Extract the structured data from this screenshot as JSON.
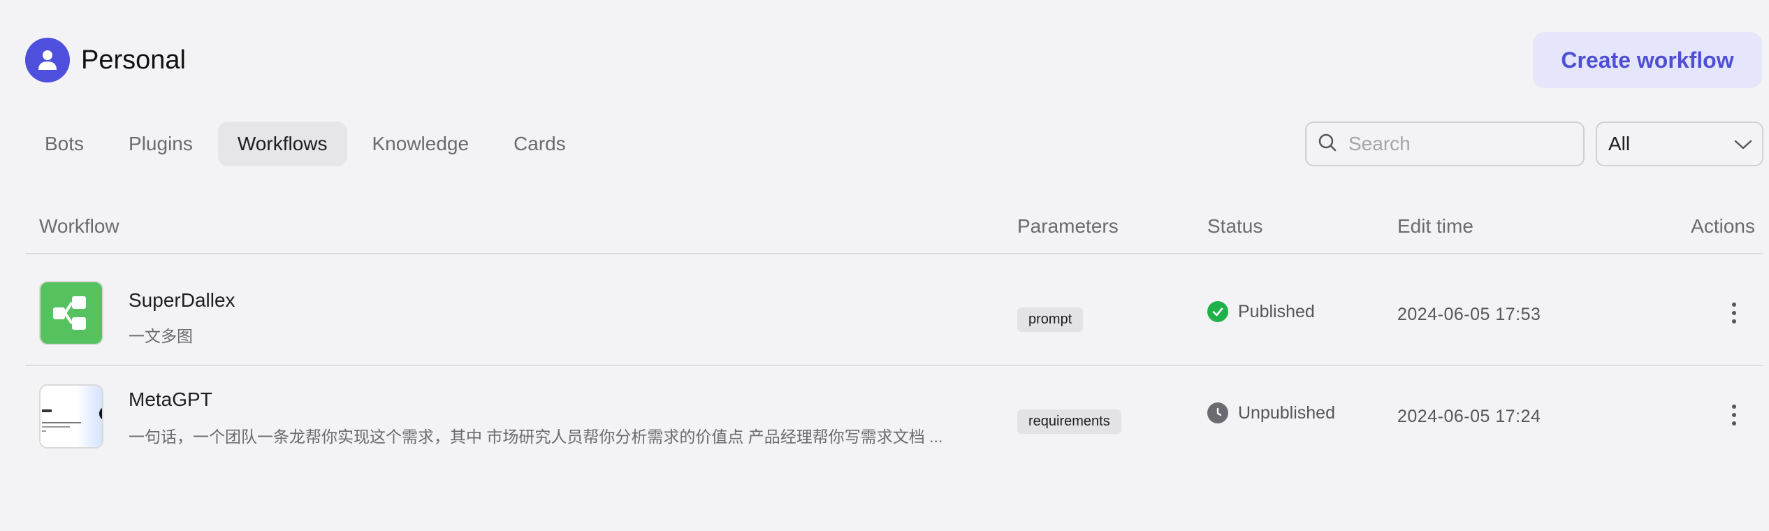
{
  "header": {
    "title": "Personal",
    "avatar_icon": "user-icon",
    "create_label": "Create workflow",
    "accent": "#4f4fd6"
  },
  "tabs": [
    {
      "label": "Bots",
      "active": false
    },
    {
      "label": "Plugins",
      "active": false
    },
    {
      "label": "Workflows",
      "active": true
    },
    {
      "label": "Knowledge",
      "active": false
    },
    {
      "label": "Cards",
      "active": false
    }
  ],
  "search": {
    "placeholder": "Search",
    "value": ""
  },
  "filter": {
    "selected": "All"
  },
  "table": {
    "columns": [
      "Workflow",
      "Parameters",
      "Status",
      "Edit time",
      "Actions"
    ],
    "rows": [
      {
        "name": "SuperDallex",
        "description": "一文多图",
        "thumb_icon": "workflow-icon",
        "parameter": "prompt",
        "status": "Published",
        "status_color": "#1fb24a",
        "edit_time": "2024-06-05 17:53"
      },
      {
        "name": "MetaGPT",
        "description": "一句话，一个团队一条龙帮你实现这个需求，其中 市场研究人员帮你分析需求的价值点 产品经理帮你写需求文档 ...",
        "thumb_icon": "image-thumbnail",
        "parameter": "requirements",
        "status": "Unpublished",
        "status_color": "#6a6a70",
        "edit_time": "2024-06-05 17:24"
      }
    ]
  }
}
